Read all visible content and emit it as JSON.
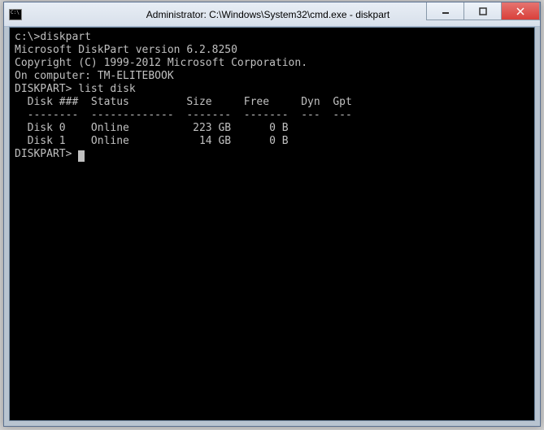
{
  "titlebar": {
    "icon_label": "C:\\",
    "title": "Administrator: C:\\Windows\\System32\\cmd.exe - diskpart"
  },
  "console": {
    "line1_prompt": "c:\\>",
    "line1_cmd": "diskpart",
    "blank1": "",
    "version": "Microsoft DiskPart version 6.2.8250",
    "blank2": "",
    "copyright": "Copyright (C) 1999-2012 Microsoft Corporation.",
    "computer": "On computer: TM-ELITEBOOK",
    "blank3": "",
    "prompt2": "DISKPART> ",
    "cmd2": "list disk",
    "blank4": "",
    "header": "  Disk ###  Status         Size     Free     Dyn  Gpt",
    "divider": "  --------  -------------  -------  -------  ---  ---",
    "row0": "  Disk 0    Online          223 GB      0 B           ",
    "row1": "  Disk 1    Online           14 GB      0 B           ",
    "blank5": "",
    "prompt3": "DISKPART> "
  }
}
